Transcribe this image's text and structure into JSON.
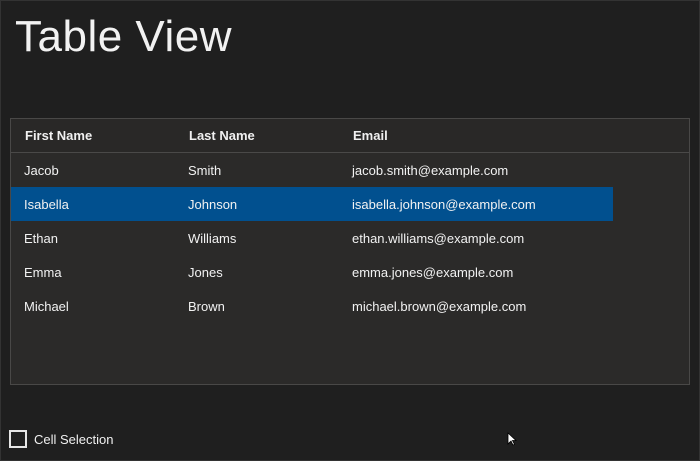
{
  "page": {
    "title": "Table View"
  },
  "table": {
    "columns": [
      "First Name",
      "Last Name",
      "Email"
    ],
    "rows": [
      {
        "first": "Jacob",
        "last": "Smith",
        "email": "jacob.smith@example.com",
        "selected": false
      },
      {
        "first": "Isabella",
        "last": "Johnson",
        "email": "isabella.johnson@example.com",
        "selected": true
      },
      {
        "first": "Ethan",
        "last": "Williams",
        "email": "ethan.williams@example.com",
        "selected": false
      },
      {
        "first": "Emma",
        "last": "Jones",
        "email": "emma.jones@example.com",
        "selected": false
      },
      {
        "first": "Michael",
        "last": "Brown",
        "email": "michael.brown@example.com",
        "selected": false
      }
    ]
  },
  "options": {
    "cell_selection_label": "Cell Selection",
    "cell_selection_checked": false
  },
  "colors": {
    "background": "#1f1f1f",
    "table_background": "#2b2a29",
    "selection": "#01508f",
    "text": "#f2f2f2"
  },
  "icons": {
    "cursor": "mouse-pointer-icon"
  }
}
